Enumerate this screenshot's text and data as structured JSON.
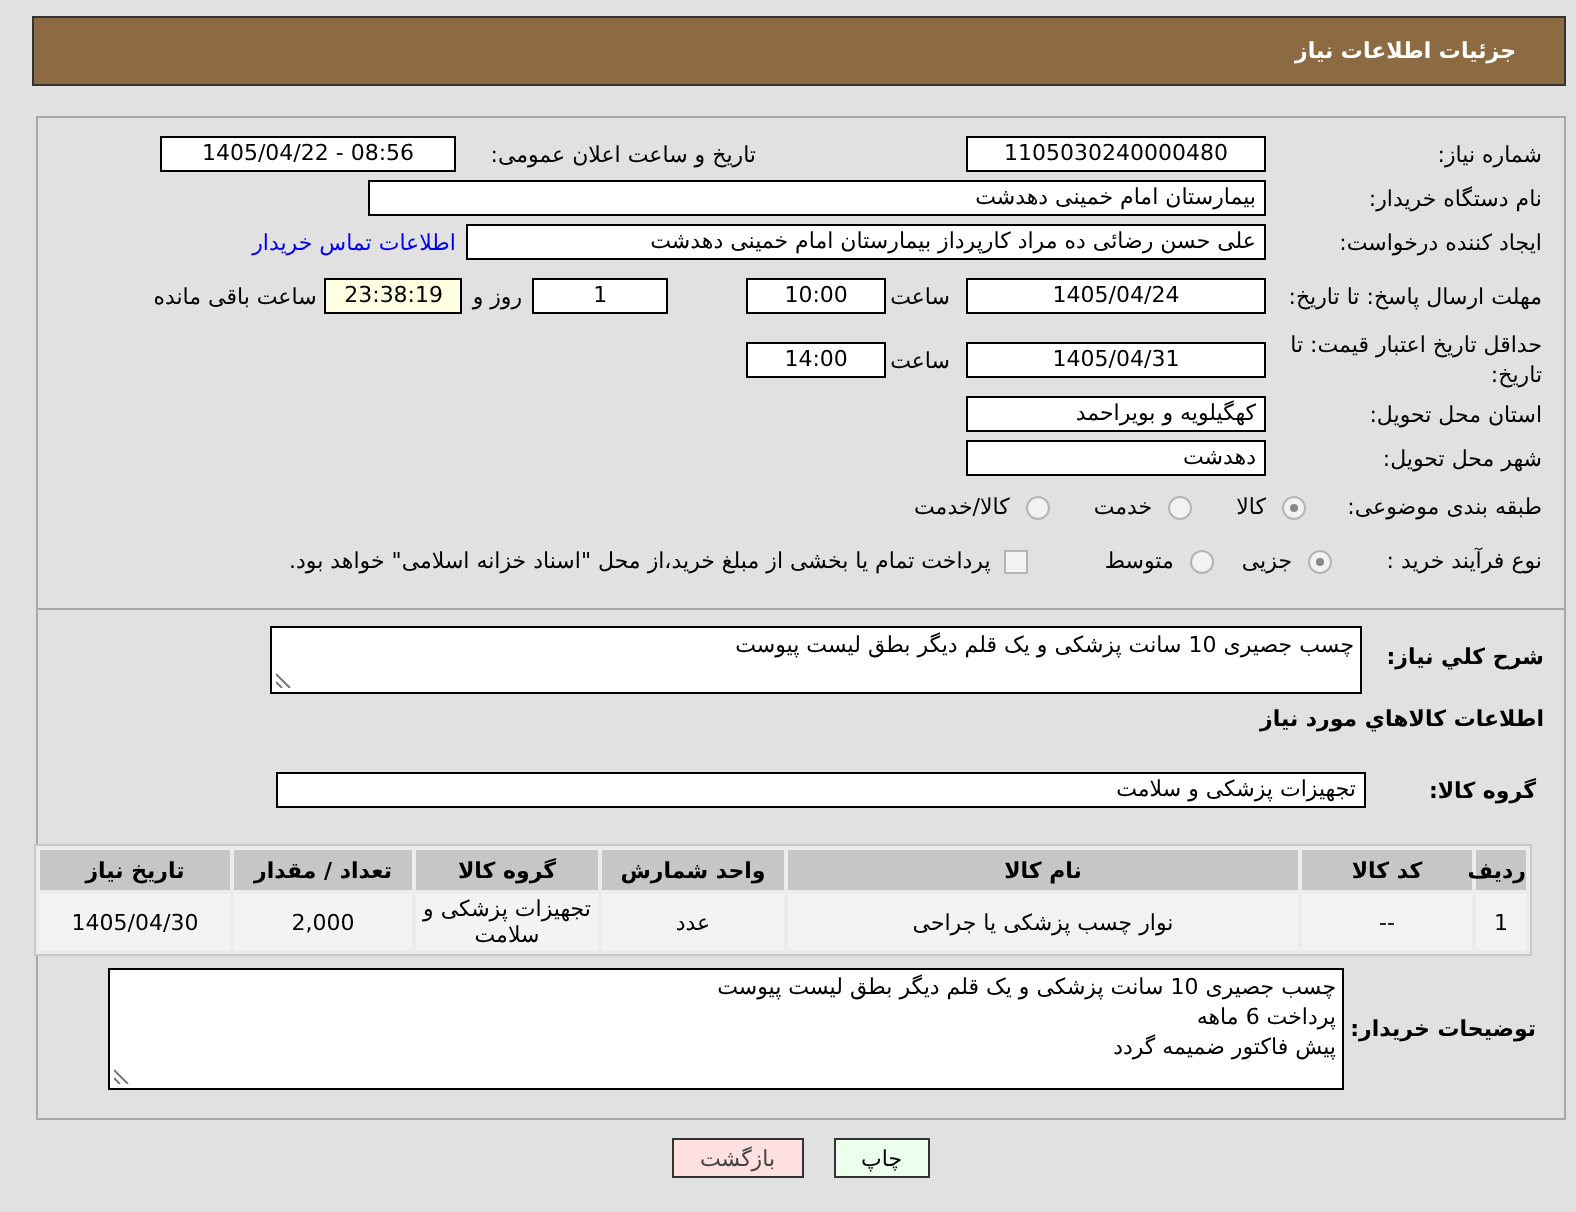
{
  "header": {
    "title": "جزئیات اطلاعات نیاز"
  },
  "need_number": {
    "label": "شماره نیاز:",
    "value": "1105030240000480"
  },
  "announce": {
    "label": "تاریخ و ساعت اعلان عمومی:",
    "value": "1405/04/22 - 08:56"
  },
  "buyer": {
    "label": "نام دستگاه خریدار:",
    "value": "بیمارستان امام خمینی دهدشت"
  },
  "creator": {
    "label": "ایجاد کننده درخواست:",
    "value": "علی حسن رضائی ده مراد کارپرداز بیمارستان امام خمینی دهدشت",
    "link": "اطلاعات تماس خریدار"
  },
  "deadline": {
    "label": "مهلت ارسال پاسخ: تا تاریخ:",
    "date": "1405/04/24",
    "time_label": "ساعت",
    "time": "10:00",
    "days": "1",
    "days_label": "روز و",
    "remaining": "23:38:19",
    "remaining_label": "ساعت باقی مانده"
  },
  "validity": {
    "label": "حداقل تاریخ اعتبار قیمت: تا تاریخ:",
    "date": "1405/04/31",
    "time_label": "ساعت",
    "time": "14:00"
  },
  "province": {
    "label": "استان محل تحویل:",
    "value": "کهگیلویه و بویراحمد"
  },
  "city": {
    "label": "شهر محل تحویل:",
    "value": "دهدشت"
  },
  "category": {
    "label": "طبقه بندی موضوعی:",
    "options": [
      {
        "label": "کالا",
        "selected": true
      },
      {
        "label": "خدمت",
        "selected": false
      },
      {
        "label": "کالا/خدمت",
        "selected": false
      }
    ]
  },
  "process": {
    "label": "نوع فرآیند خرید :",
    "options": [
      {
        "label": "جزیی",
        "selected": true
      },
      {
        "label": "متوسط",
        "selected": false
      }
    ],
    "payment": {
      "checked": false,
      "text": "پرداخت تمام یا بخشی از مبلغ خرید،از محل \"اسناد خزانه اسلامی\" خواهد بود."
    }
  },
  "description": {
    "label": "شرح کلي نياز:",
    "value": "چسب جصیری 10 سانت پزشکی و یک قلم دیگر بطق لیست پیوست"
  },
  "goods_heading": "اطلاعات کالاهاي مورد نياز",
  "goods_group": {
    "label": "گروه کالا:",
    "value": "تجهیزات پزشکی و سلامت"
  },
  "table": {
    "columns": [
      "ردیف",
      "کد کالا",
      "نام کالا",
      "واحد شمارش",
      "گروه کالا",
      "تعداد / مقدار",
      "تاریخ نیاز"
    ],
    "rows": [
      [
        "1",
        "--",
        "نوار چسب پزشکی یا جراحی",
        "عدد",
        "تجهیزات پزشکی و سلامت",
        "2,000",
        "1405/04/30"
      ]
    ]
  },
  "buyer_notes": {
    "label": "توضیحات خریدار:",
    "lines": [
      "چسب جصیری 10 سانت پزشکی و یک قلم دیگر بطق لیست پیوست",
      "پرداخت 6 ماهه",
      "پیش فاکتور ضمیمه گردد"
    ]
  },
  "buttons": [
    {
      "label": "چاپ",
      "kind": "print"
    },
    {
      "label": "بازگشت",
      "kind": "back"
    }
  ]
}
